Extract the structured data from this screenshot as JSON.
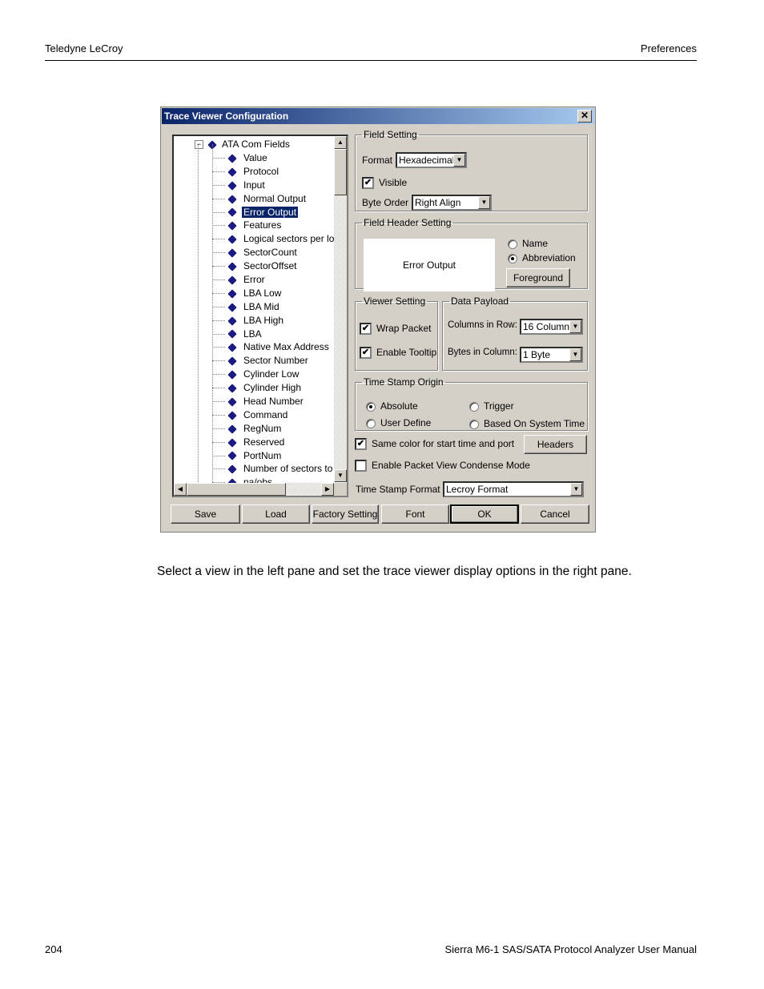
{
  "page": {
    "header_left": "Teledyne LeCroy",
    "header_right": "Preferences",
    "footer_left": "204",
    "footer_right": "Sierra M6-1 SAS/SATA Protocol Analyzer User Manual",
    "caption": "Select a view in the left pane and set the trace viewer display options in the right pane."
  },
  "dialog": {
    "title": "Trace Viewer Configuration",
    "close_icon": "close-icon",
    "tree": {
      "root": "ATA Com Fields",
      "root_expander": "−",
      "selected_index": 5,
      "items": [
        "Value",
        "Protocol",
        "Input",
        "Normal Output",
        "Error Output",
        "Features",
        "Logical sectors per logi",
        "SectorCount",
        "SectorOffset",
        "Error",
        "LBA Low",
        "LBA Mid",
        "LBA High",
        "LBA",
        "Native Max Address",
        "Sector Number",
        "Cylinder Low",
        "Cylinder High",
        "Head Number",
        "Command",
        "RegNum",
        "Reserved",
        "PortNum",
        "Number of sectors to b",
        "na/obs"
      ]
    },
    "field_setting": {
      "legend": "Field Setting",
      "format_label": "Format",
      "format_value": "Hexadecimal",
      "visible_label": "Visible",
      "visible_checked": true,
      "byte_order_label": "Byte Order",
      "byte_order_value": "Right Align"
    },
    "field_header_setting": {
      "legend": "Field Header Setting",
      "preview_text": "Error Output",
      "name_label": "Name",
      "name_selected": false,
      "abbreviation_label": "Abbreviation",
      "abbreviation_selected": true,
      "foreground_button": "Foreground"
    },
    "viewer_setting": {
      "legend": "Viewer Setting",
      "wrap_packet_label": "Wrap Packet",
      "wrap_packet_checked": true,
      "enable_tooltips_label": "Enable Tooltips",
      "enable_tooltips_checked": true
    },
    "data_payload": {
      "legend": "Data Payload",
      "columns_label": "Columns in Row:",
      "columns_value": "16  Column",
      "bytes_label": "Bytes in Column:",
      "bytes_value": "1  Byte"
    },
    "time_stamp_origin": {
      "legend": "Time Stamp Origin",
      "absolute": "Absolute",
      "trigger": "Trigger",
      "user_define": "User Define",
      "based_on_system_time": "Based On System Time",
      "selected": "Absolute"
    },
    "same_color_label": "Same color for start time and port",
    "same_color_checked": true,
    "headers_button": "Headers",
    "condense_label": "Enable Packet View Condense Mode",
    "condense_checked": false,
    "ts_format_label": "Time Stamp Format",
    "ts_format_value": "Lecroy Format",
    "buttons": {
      "save": "Save",
      "load": "Load",
      "factory": "Factory Setting",
      "font": "Font",
      "ok": "OK",
      "cancel": "Cancel"
    },
    "check_mark": "✔",
    "arrow_down": "▼",
    "arrow_up": "▲",
    "arrow_left": "◀",
    "arrow_right": "▶",
    "close_glyph": "✕"
  }
}
